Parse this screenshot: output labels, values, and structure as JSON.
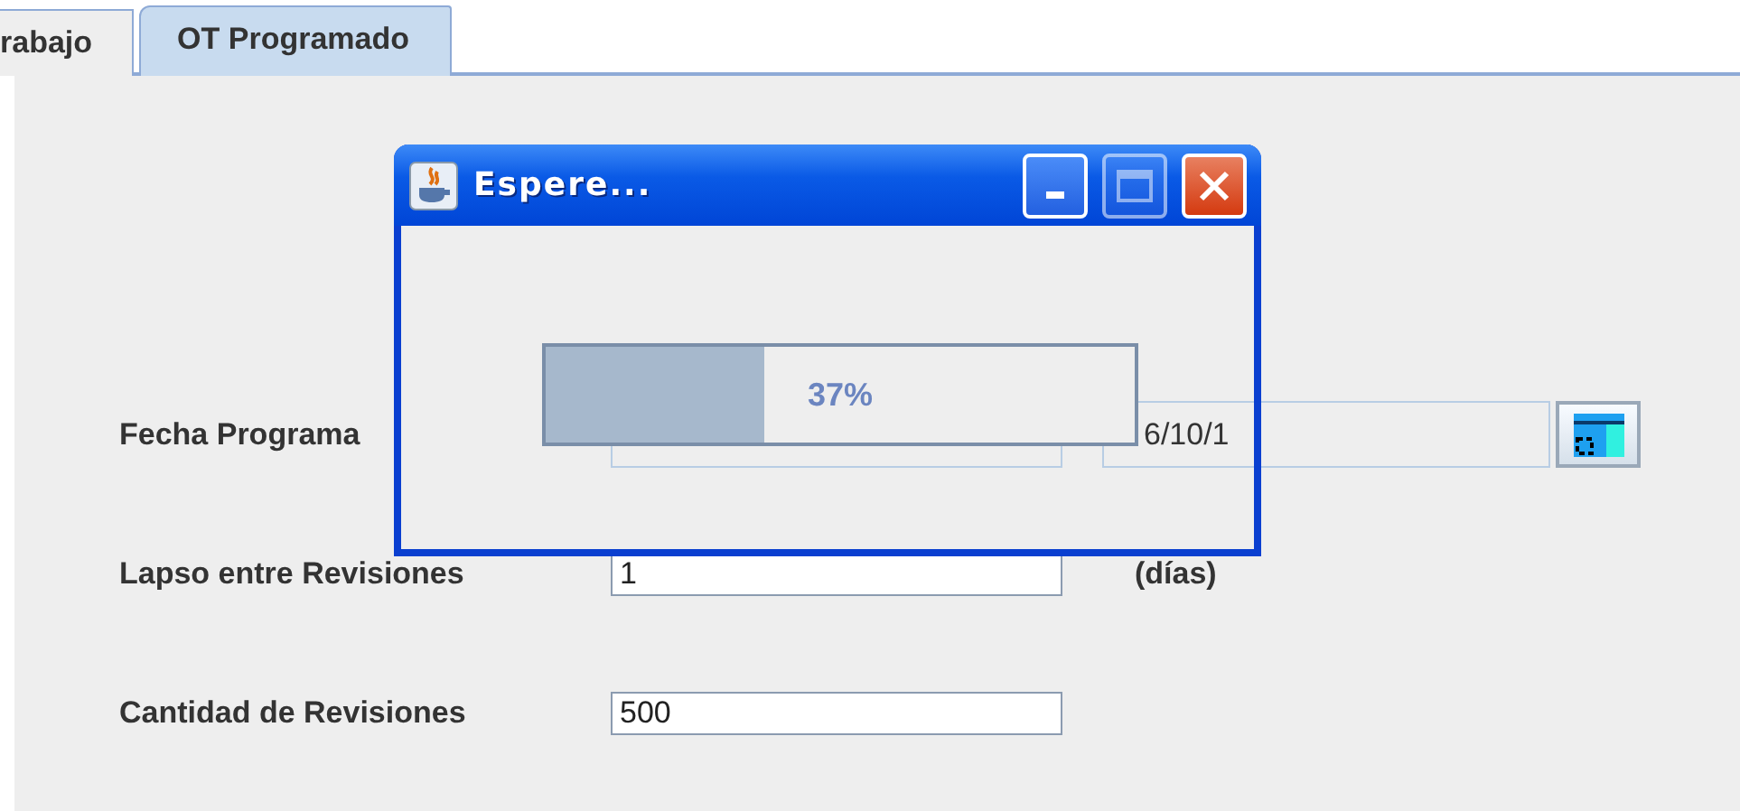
{
  "tabs": [
    {
      "label": "rabajo",
      "selected": false
    },
    {
      "label": "OT Programado",
      "selected": true
    }
  ],
  "form": {
    "fecha_programa": {
      "label": "Fecha Programa",
      "date_value": "6/10/1"
    },
    "lapso": {
      "label": "Lapso entre Revisiones",
      "value": "1",
      "unit": "(días)"
    },
    "cantidad": {
      "label": "Cantidad de Revisiones",
      "value": "500"
    }
  },
  "dialog": {
    "title": "Espere...",
    "progress": {
      "level": 0.37,
      "text": "37%"
    }
  }
}
